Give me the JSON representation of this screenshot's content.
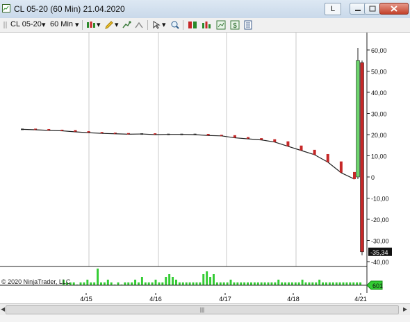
{
  "window": {
    "title": "CL 05-20 (60 Min)  21.04.2020",
    "link_button": "L"
  },
  "toolbar": {
    "instrument": "CL 05-20",
    "interval": "60 Min"
  },
  "chart_data": {
    "type": "candlestick",
    "instrument": "CL 05-20",
    "period": "60 Min",
    "y_ticks": [
      "60,00",
      "50,00",
      "40,00",
      "30,00",
      "20,00",
      "10,00",
      "0",
      "-10,00",
      "-20,00",
      "-30,00",
      "-40,00"
    ],
    "ylim": [
      -40,
      60
    ],
    "x_ticks": [
      "4/15",
      "4/16",
      "4/17",
      "4/18",
      "4/21"
    ],
    "last_price_label": "-35,34",
    "volume_label": "601",
    "copyright": "© 2020 NinjaTrader, LLC",
    "price_series": [
      {
        "x": "4/14",
        "close": 22.5
      },
      {
        "x": "4/14",
        "close": 22.3
      },
      {
        "x": "4/14",
        "close": 22.0
      },
      {
        "x": "4/14",
        "close": 21.8
      },
      {
        "x": "4/15",
        "close": 21.3
      },
      {
        "x": "4/15",
        "close": 20.9
      },
      {
        "x": "4/15",
        "close": 20.6
      },
      {
        "x": "4/15",
        "close": 20.4
      },
      {
        "x": "4/16",
        "close": 20.2
      },
      {
        "x": "4/16",
        "close": 20.3
      },
      {
        "x": "4/16",
        "close": 20.0
      },
      {
        "x": "4/16",
        "close": 20.1
      },
      {
        "x": "4/17",
        "close": 20.1
      },
      {
        "x": "4/17",
        "close": 20.0
      },
      {
        "x": "4/17",
        "close": 19.6
      },
      {
        "x": "4/17",
        "close": 19.4
      },
      {
        "x": "4/18",
        "close": 18.5
      },
      {
        "x": "4/18",
        "close": 18.0
      },
      {
        "x": "4/18",
        "close": 17.5
      },
      {
        "x": "4/18",
        "close": 16.5
      },
      {
        "x": "4/20",
        "close": 14.5
      },
      {
        "x": "4/20",
        "close": 12.5
      },
      {
        "x": "4/20",
        "close": 10.5
      },
      {
        "x": "4/20",
        "close": 7.0
      },
      {
        "x": "4/20",
        "close": 2.0
      },
      {
        "x": "4/20",
        "close": -1.0
      }
    ],
    "final_candles": [
      {
        "open": 0.0,
        "high": 61.0,
        "low": -1.0,
        "close": 55.0,
        "direction": "up"
      },
      {
        "open": 54.0,
        "high": 55.0,
        "low": -37.0,
        "close": -35.34,
        "direction": "down"
      }
    ],
    "volume_bars": [
      2,
      1,
      1,
      1,
      0,
      1,
      1,
      2,
      1,
      1,
      6,
      1,
      1,
      2,
      1,
      0,
      1,
      0,
      1,
      1,
      1,
      2,
      1,
      3,
      1,
      1,
      1,
      2,
      1,
      1,
      3,
      4,
      3,
      2,
      1,
      1,
      1,
      1,
      1,
      1,
      1,
      4,
      5,
      3,
      4,
      1,
      1,
      1,
      1,
      2,
      1,
      1,
      1,
      1,
      1,
      1,
      1,
      1,
      1,
      1,
      1,
      1,
      1,
      2,
      1,
      1,
      1,
      1,
      1,
      1,
      2,
      1,
      1,
      1,
      1,
      2,
      1,
      1,
      1,
      1,
      1,
      1,
      1,
      1,
      1,
      1,
      1,
      1
    ],
    "colors": {
      "up": "#6dd46d",
      "down": "#c62828",
      "volume": "#33cc33",
      "line": "#111111"
    }
  }
}
